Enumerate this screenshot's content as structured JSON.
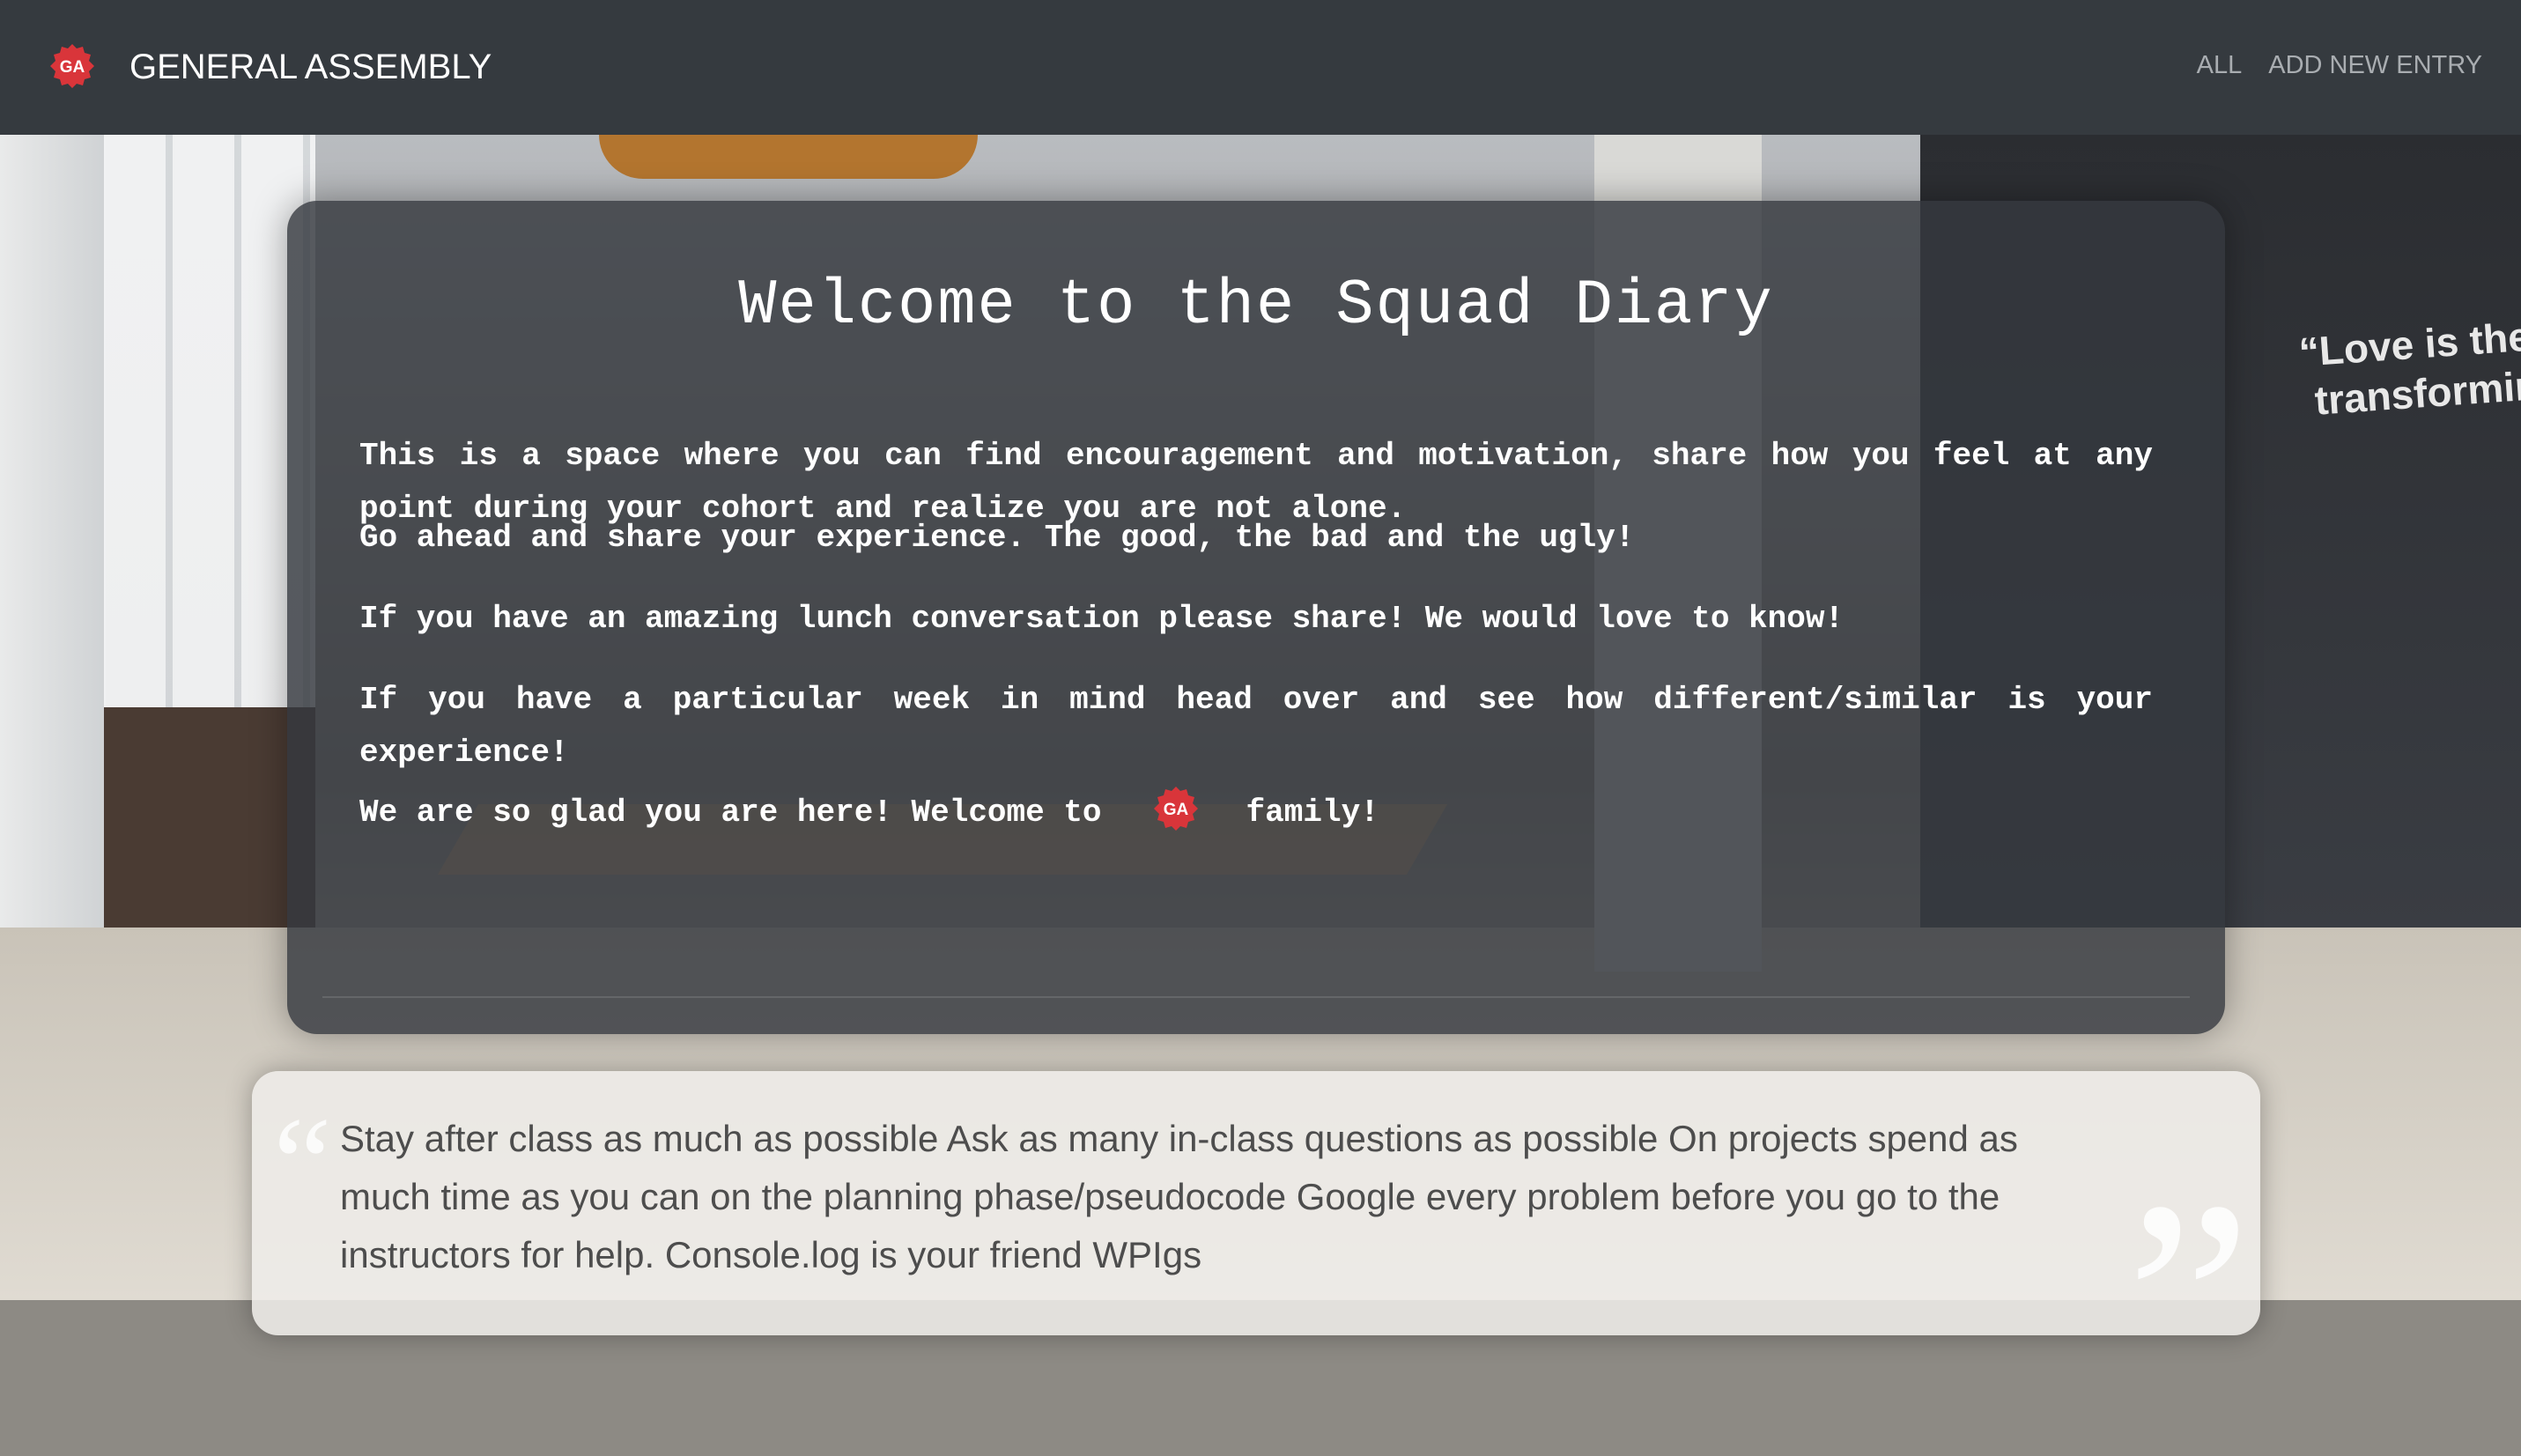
{
  "navbar": {
    "logo_text": "GA",
    "brand": "GENERAL ASSEMBLY",
    "links": [
      "ALL",
      "ADD NEW ENTRY"
    ]
  },
  "background": {
    "mural_quote_line1": "“Love is the",
    "mural_quote_line2": "transforming"
  },
  "welcome": {
    "title": "Welcome to the Squad Diary",
    "paragraphs": [
      "This is a space where you can find encouragement and motivation, share how you feel at any point during your cohort and realize you are not alone.",
      "Go ahead and share your experience. The good, the bad and the ugly!",
      "If you have an amazing lunch conversation please share! We would love to know!",
      "If you have a particular week in mind head over and see how different/similar is your experience!"
    ],
    "closing_before": "We are so glad you are here! Welcome to",
    "closing_logo": "GA",
    "closing_after": "family!"
  },
  "entry": {
    "text": "Stay after class as much as possible Ask as many in-class questions as possible On projects spend as much time as you can on the planning phase/pseudocode Google every problem before you go to the instructors for help. Console.log is your friend WPIgs"
  },
  "colors": {
    "navbar": "#353a3f",
    "brand_red": "#d9353a",
    "nav_link": "#a9adb1"
  },
  "icons": {
    "brand": "ga-logo-icon",
    "quote_open": "open-quote-icon",
    "quote_close": "close-quote-icon"
  }
}
